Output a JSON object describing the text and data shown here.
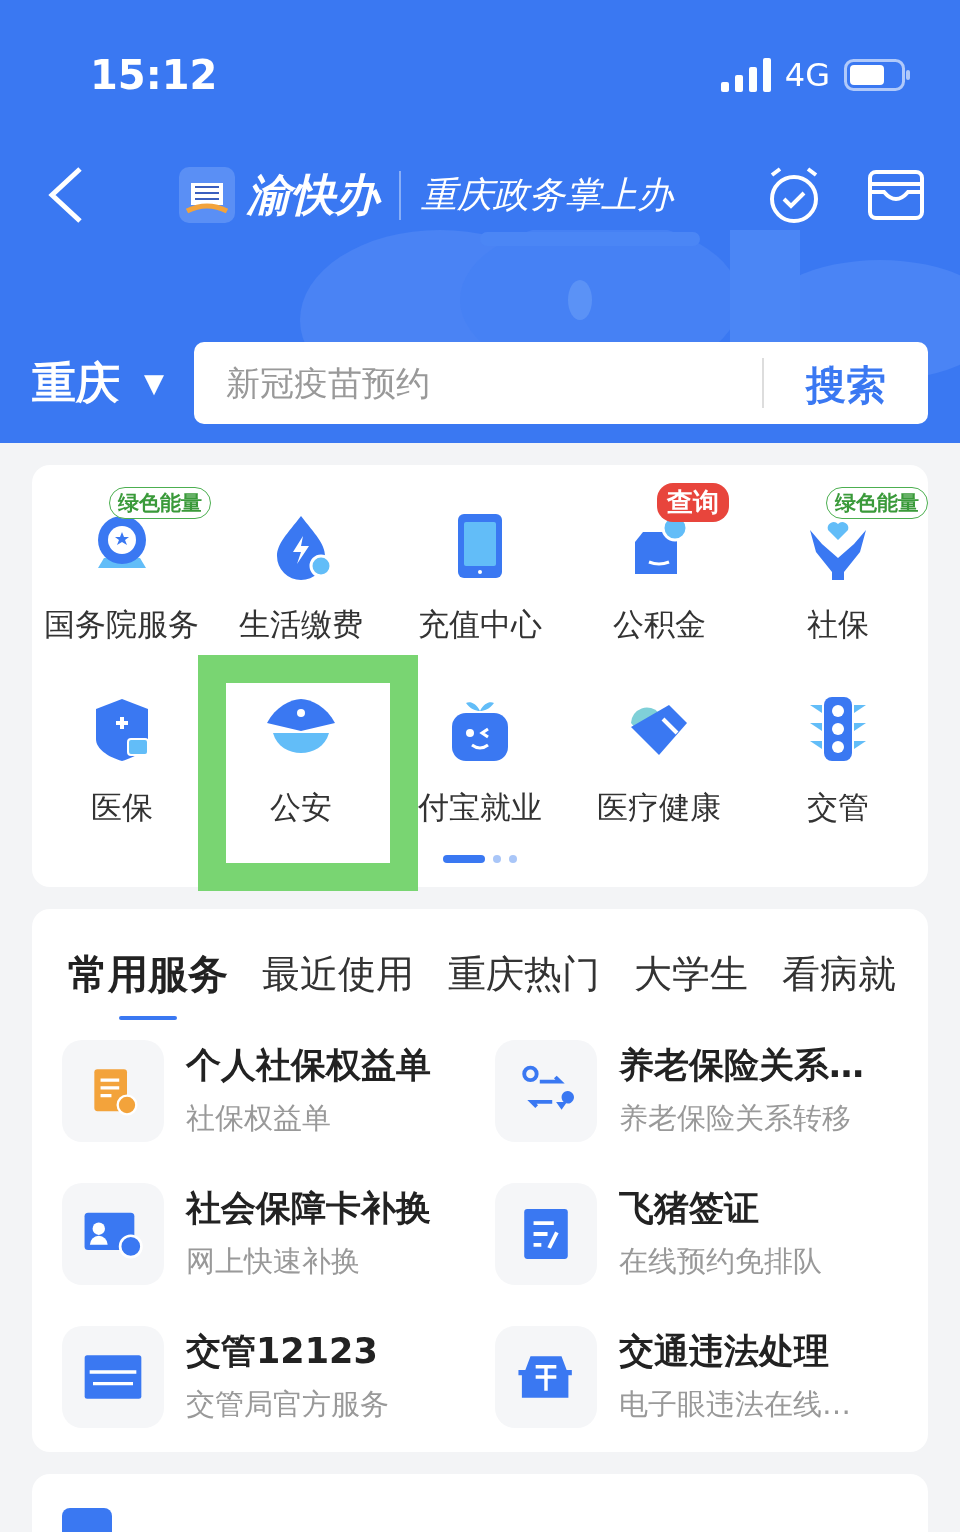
{
  "status_bar": {
    "time": "15:12",
    "network": "4G"
  },
  "header": {
    "app_name": "渝快办",
    "slogan": "重庆政务掌上办"
  },
  "city": {
    "name": "重庆",
    "arrow": "▼"
  },
  "search": {
    "placeholder": "新冠疫苗预约",
    "button": "搜索"
  },
  "grid": {
    "items": [
      {
        "label": "国务院服务",
        "badge": {
          "text": "绿色能量",
          "kind": "outline"
        }
      },
      {
        "label": "生活缴费"
      },
      {
        "label": "充值中心"
      },
      {
        "label": "公积金",
        "badge": {
          "text": "查询",
          "kind": "filled"
        }
      },
      {
        "label": "社保",
        "badge": {
          "text": "绿色能量",
          "kind": "outline"
        }
      },
      {
        "label": "医保"
      },
      {
        "label": "公安"
      },
      {
        "label": "付宝就业"
      },
      {
        "label": "医疗健康"
      },
      {
        "label": "交管"
      }
    ],
    "pages": [
      {
        "selected": true
      },
      {
        "selected": false
      },
      {
        "selected": false
      }
    ]
  },
  "service_tabs": [
    {
      "label": "常用服务",
      "selected": true
    },
    {
      "label": "最近使用",
      "selected": false
    },
    {
      "label": "重庆热门",
      "selected": false
    },
    {
      "label": "大学生",
      "selected": false
    },
    {
      "label": "看病就",
      "selected": false
    }
  ],
  "services": [
    {
      "title": "个人社保权益单",
      "subtitle": "社保权益单"
    },
    {
      "title": "养老保险关系…",
      "subtitle": "养老保险关系转移"
    },
    {
      "title": "社会保障卡补换",
      "subtitle": "网上快速补换"
    },
    {
      "title": "飞猪签证",
      "subtitle": "在线预约免排队"
    },
    {
      "title": "交管12123",
      "subtitle": "交管局官方服务"
    },
    {
      "title": "交通违法处理",
      "subtitle": "电子眼违法在线…"
    }
  ]
}
